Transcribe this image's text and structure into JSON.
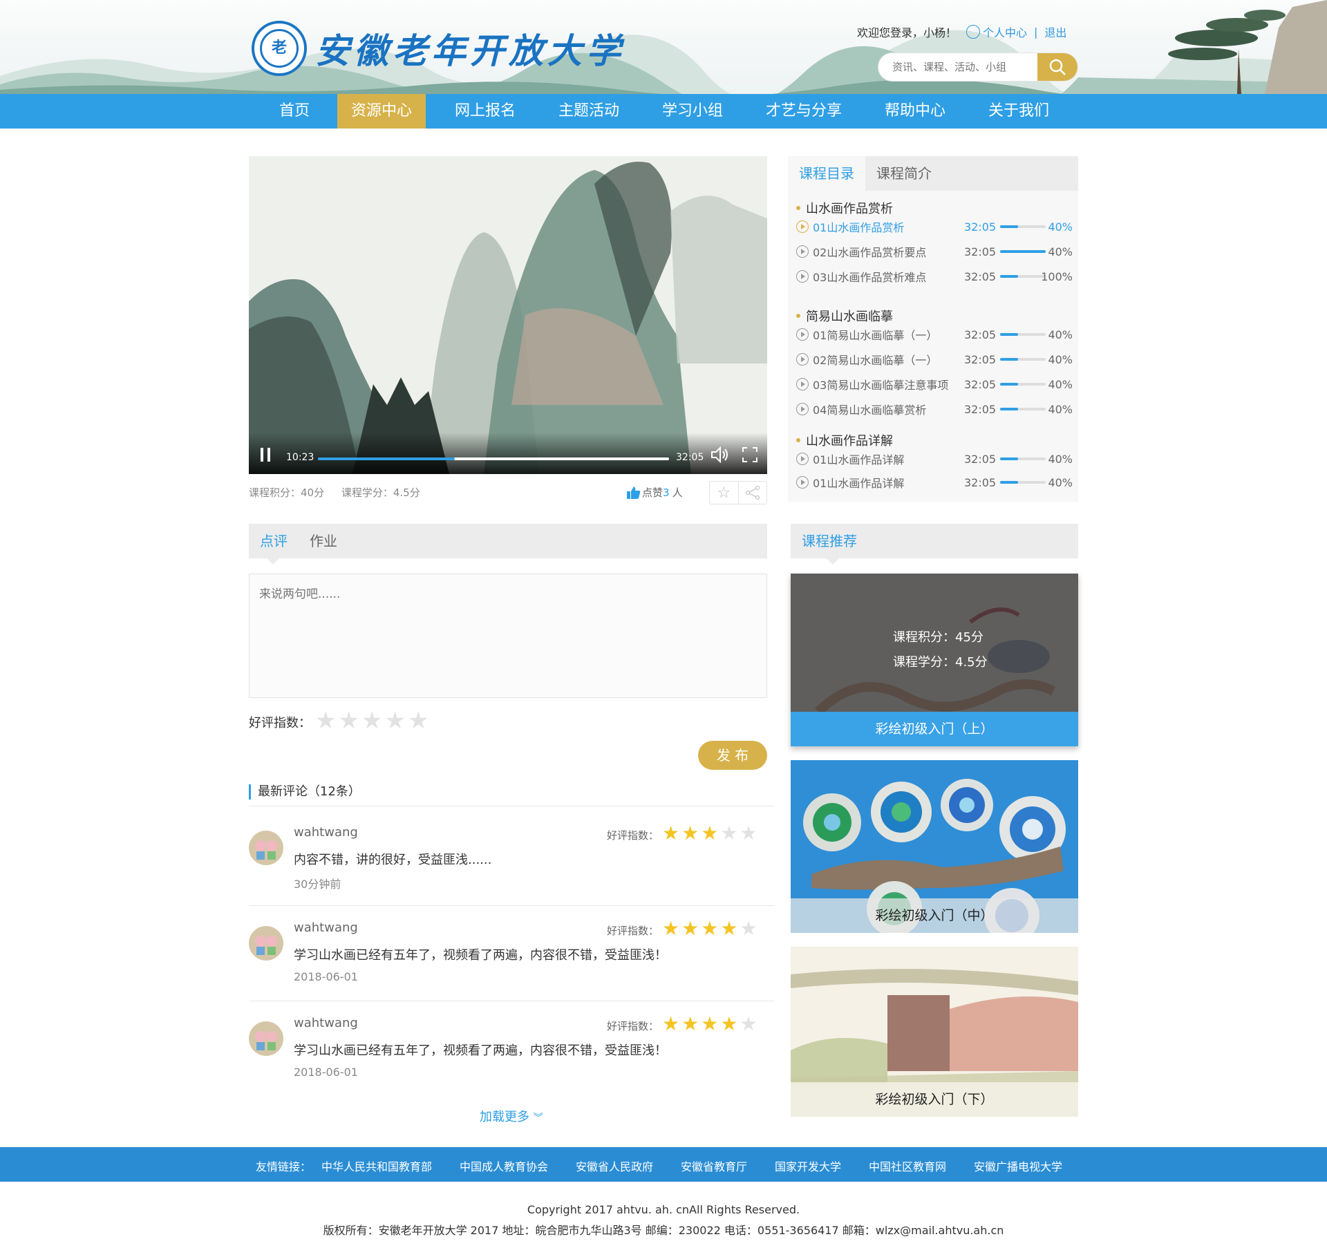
{
  "header": {
    "school_name": "安徽老年开放大学",
    "welcome": "欢迎您登录，小杨！",
    "personal_center": "个人中心",
    "logout": "退出",
    "search_placeholder": "资讯、课程、活动、小组"
  },
  "nav": {
    "items": [
      "首页",
      "资源中心",
      "网上报名",
      "主题活动",
      "学习小组",
      "才艺与分享",
      "帮助中心",
      "关于我们"
    ],
    "active": "资源中心"
  },
  "player": {
    "current_time": "10:23",
    "duration": "32:05",
    "progress_fraction": 0.39
  },
  "course_meta": {
    "points": "课程积分：40分",
    "credits": "课程学分：4.5分",
    "like_label": "点赞",
    "like_count": "3",
    "like_unit": "人"
  },
  "catalog": {
    "tabs": [
      "课程目录",
      "课程简介"
    ],
    "sections": [
      {
        "title": "山水画作品赏析",
        "lessons": [
          {
            "title": "01山水画作品赏析",
            "duration": "32:05",
            "progress": "40%",
            "fraction": 0.4,
            "current": true
          },
          {
            "title": "02山水画作品赏析要点",
            "duration": "32:05",
            "progress": "40%",
            "fraction": 1.0
          },
          {
            "title": "03山水画作品赏析难点",
            "duration": "32:05",
            "progress": "100%",
            "fraction": 0.4
          }
        ]
      },
      {
        "title": "简易山水画临摹",
        "lessons": [
          {
            "title": "01简易山水画临摹（一）",
            "duration": "32:05",
            "progress": "40%",
            "fraction": 0.4
          },
          {
            "title": "02简易山水画临摹（一）",
            "duration": "32:05",
            "progress": "40%",
            "fraction": 0.4
          },
          {
            "title": "03简易山水画临摹注意事项",
            "duration": "32:05",
            "progress": "40%",
            "fraction": 0.4
          },
          {
            "title": "04简易山水画临摹赏析",
            "duration": "32:05",
            "progress": "40%",
            "fraction": 0.4
          }
        ]
      },
      {
        "title": "山水画作品详解",
        "lessons": [
          {
            "title": "01山水画作品详解",
            "duration": "32:05",
            "progress": "40%",
            "fraction": 0.4
          },
          {
            "title": "01山水画作品详解",
            "duration": "32:05",
            "progress": "40%",
            "fraction": 0.4
          }
        ]
      }
    ]
  },
  "comment": {
    "tabs": [
      "点评",
      "作业"
    ],
    "placeholder": "来说两句吧......",
    "rating_label": "好评指数：",
    "publish": "发 布",
    "latest_title": "最新评论（12条）",
    "items": [
      {
        "user": "wahtwang",
        "text": "内容不错，讲的很好，受益匪浅......",
        "time": "30分钟前",
        "stars": 3
      },
      {
        "user": "wahtwang",
        "text": "学习山水画已经有五年了，视频看了两遍，内容很不错，受益匪浅！",
        "time": "2018-06-01",
        "stars": 4
      },
      {
        "user": "wahtwang",
        "text": "学习山水画已经有五年了，视频看了两遍，内容很不错，受益匪浅！",
        "time": "2018-06-01",
        "stars": 4
      }
    ],
    "item_rating_label": "好评指数：",
    "load_more": "加载更多"
  },
  "recommend": {
    "title": "课程推荐",
    "overlay_points": "课程积分：45分",
    "overlay_credits": "课程学分：4.5分",
    "cards": [
      "彩绘初级入门（上）",
      "彩绘初级入门（中）",
      "彩绘初级入门（下）"
    ]
  },
  "footer": {
    "links_label": "友情链接：",
    "links": [
      "中华人民共和国教育部",
      "中国成人教育协会",
      "安徽省人民政府",
      "安徽省教育厅",
      "国家开发大学",
      "中国社区教育网",
      "安徽广播电视大学"
    ],
    "copyright": "Copyright 2017 ahtvu. ah. cnAll Rights Reserved.",
    "info": "版权所有：安徽老年开放大学 2017 地址：皖合肥市九华山路3号 邮编：230022 电话：0551-3656417 邮箱：wlzx@mail.ahtvu.ah.cn"
  },
  "colors": {
    "primary": "#2f9fe5",
    "gold": "#d7b24a",
    "footer": "#2a8dd4",
    "star": "#f4c425"
  }
}
